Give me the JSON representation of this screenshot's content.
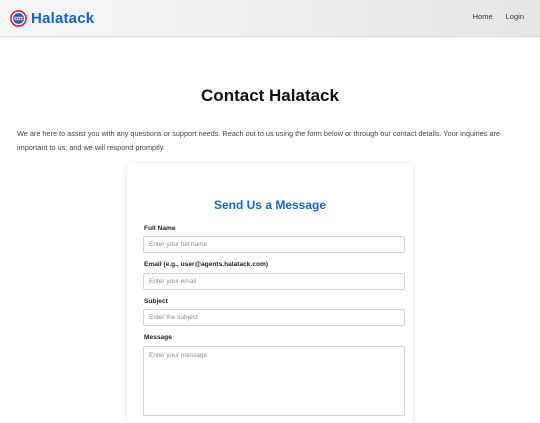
{
  "header": {
    "brand_name": "Halatack",
    "brand_logo_icon": "halatack-logo-icon",
    "brand_color": "#1863c6",
    "nav": [
      {
        "label": "Home"
      },
      {
        "label": "Login"
      }
    ]
  },
  "main": {
    "title": "Contact Halatack",
    "intro": "We are here to assist you with any questions or support needs. Reach out to us using the form below or through our contact details. Your inquiries are important to us, and we will respond promptly."
  },
  "form": {
    "title": "Send Us a Message",
    "title_color": "#1c66c2",
    "fields": {
      "full_name": {
        "label": "Full Name",
        "placeholder": "Enter your full name",
        "value": ""
      },
      "email": {
        "label": "Email (e.g., user@agents.halatack.com)",
        "placeholder": "Enter your email",
        "value": ""
      },
      "subject": {
        "label": "Subject",
        "placeholder": "Enter the subject",
        "value": ""
      },
      "message": {
        "label": "Message",
        "placeholder": "Enter your message",
        "value": ""
      }
    }
  }
}
